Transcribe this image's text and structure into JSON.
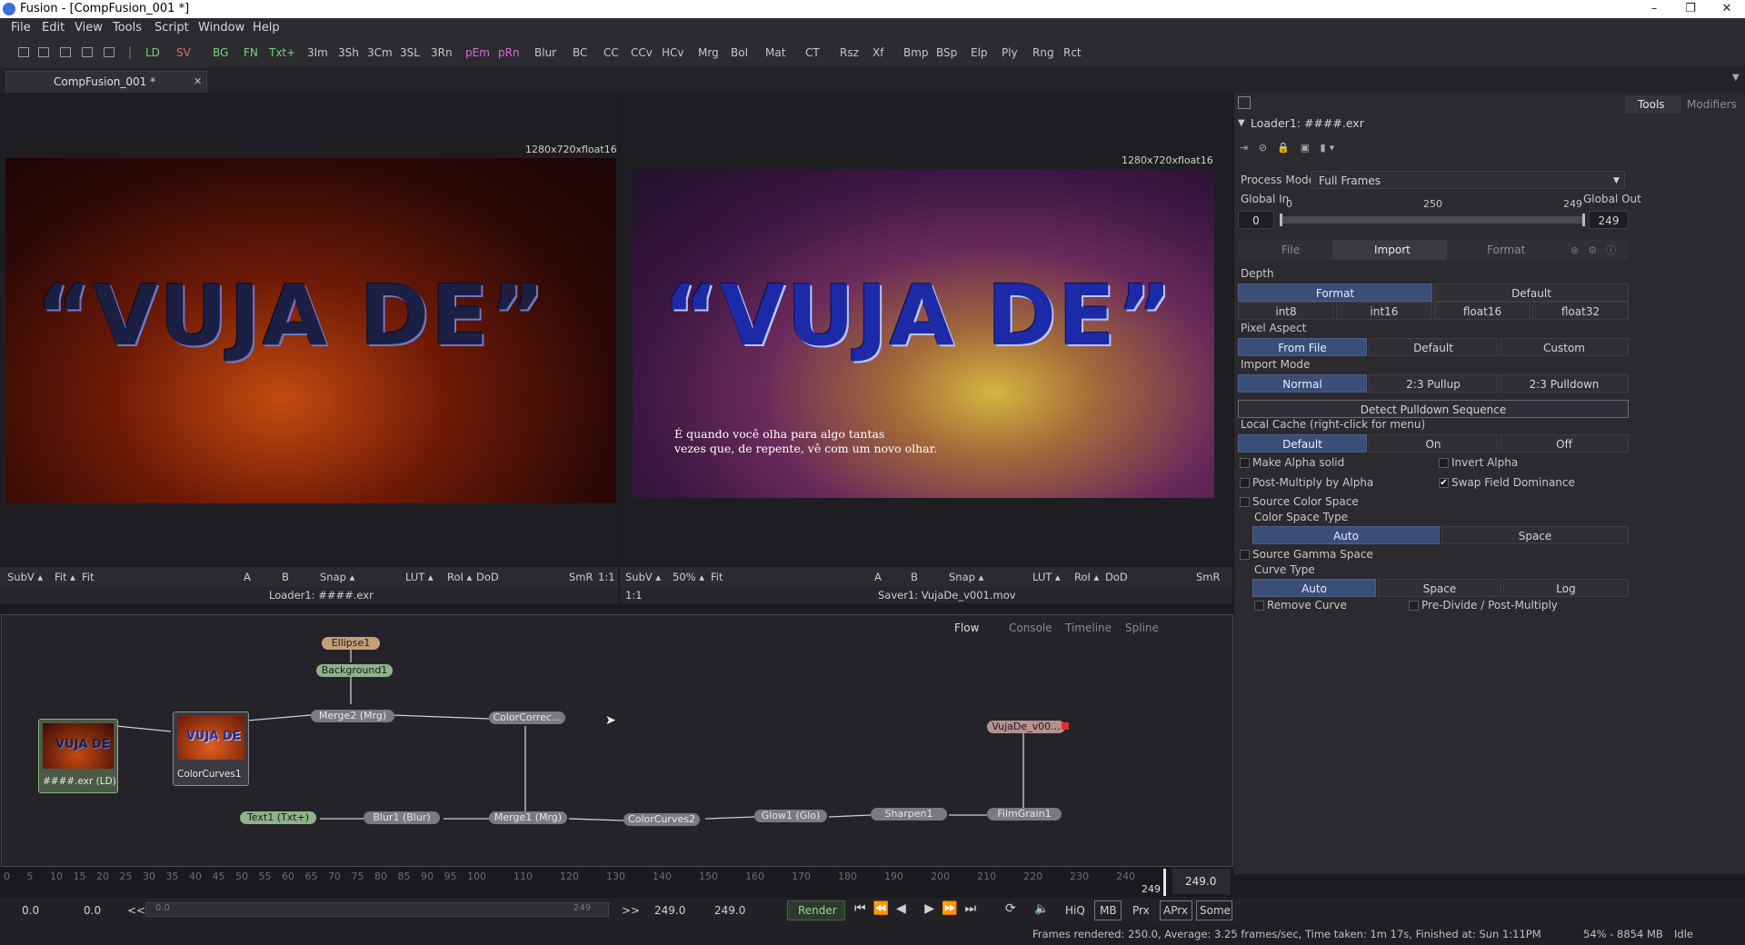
{
  "window": {
    "title": "Fusion - [CompFusion_001 *]",
    "controls": [
      "–",
      "❐",
      "✕"
    ]
  },
  "menu": [
    "File",
    "Edit",
    "View",
    "Tools",
    "Script",
    "Window",
    "Help"
  ],
  "toolbar": {
    "buttons": [
      "LD",
      "SV",
      "BG",
      "FN",
      "Txt+",
      "3Im",
      "3Sh",
      "3Cm",
      "3SL",
      "3Rn",
      "pEm",
      "pRn",
      "Blur",
      "BC",
      "CC",
      "CCv",
      "HCv",
      "Mrg",
      "BoI",
      "Mat",
      "CT",
      "Rsz",
      "Xf",
      "Bmp",
      "BSp",
      "Elp",
      "Ply",
      "Rng",
      "Rct"
    ],
    "colors": {
      "green": "#7fd17a",
      "red": "#e36b6b",
      "magenta": "#d66bd0",
      "default": "#c8c8c8"
    }
  },
  "document_tab": {
    "label": "CompFusion_001 *",
    "close": "✕"
  },
  "viewer_left": {
    "resolution": "1280x720xfloat16",
    "title_text": "“VUJA DE”",
    "toolbar": [
      "SubV ▴",
      "Fit ▴",
      "Fit",
      "A",
      "B",
      "Snap ▴",
      "LUT ▴",
      "RoI ▴",
      "DoD",
      "SmR",
      "1:1"
    ],
    "footer": "Loader1: ####.exr"
  },
  "viewer_right": {
    "resolution": "1280x720xfloat16",
    "title_text": "“VUJA DE”",
    "subtitle_line1": "É quando você olha para algo tantas",
    "subtitle_line2": "vezes que, de repente, vê com um novo olhar.",
    "toolbar": [
      "SubV ▴",
      "50% ▴",
      "Fit",
      "A",
      "B",
      "Snap ▴",
      "LUT ▴",
      "RoI ▴",
      "DoD",
      "SmR"
    ],
    "footer": "Saver1: VujaDe_v001.mov",
    "footer_left": "1:1"
  },
  "flow": {
    "tabs": [
      "Flow",
      "Console",
      "Timeline",
      "Spline"
    ],
    "nodes": {
      "ellipse": "Ellipse1",
      "background": "Background1",
      "merge2": "Merge2 (Mrg)",
      "colorcorrector": "ColorCorrec...",
      "loader": "####.exr (LD)",
      "colorcurves1": "ColorCurves1",
      "saver": "VujaDe_v00...",
      "text": "Text1 (Txt+)",
      "blur": "Blur1 (Blur)",
      "merge1": "Merge1 (Mrg)",
      "colorcurves2": "ColorCurves2",
      "glow": "Glow1 (Glo)",
      "sharpen": "Sharpen1",
      "filmgrain": "FilmGrain1",
      "thumb_text": "VUJA DE"
    }
  },
  "inspector": {
    "top_tabs": [
      "Tools",
      "Modifiers"
    ],
    "tool_name": "Loader1: ####.exr",
    "process_mode_label": "Process Mode",
    "process_mode_value": "Full Frames",
    "global_in_label": "Global In",
    "global_out_label": "Global Out",
    "global_in_value": "0",
    "global_out_value": "249",
    "slider_min": "0",
    "slider_mid": "250",
    "slider_max": "249",
    "sub_tabs": [
      "File",
      "Import",
      "Format"
    ],
    "depth_label": "Depth",
    "depth_row1": [
      "Format",
      "Default"
    ],
    "depth_row2": [
      "int8",
      "int16",
      "float16",
      "float32"
    ],
    "pixel_aspect_label": "Pixel Aspect",
    "pixel_aspect": [
      "From File",
      "Default",
      "Custom"
    ],
    "import_mode_label": "Import Mode",
    "import_mode": [
      "Normal",
      "2:3 Pullup",
      "2:3 Pulldown"
    ],
    "detect_pulldown": "Detect Pulldown Sequence",
    "local_cache_label": "Local Cache (right-click for menu)",
    "local_cache": [
      "Default",
      "On",
      "Off"
    ],
    "make_alpha_solid": "Make Alpha solid",
    "invert_alpha": "Invert Alpha",
    "post_multiply": "Post-Multiply by Alpha",
    "swap_field": "Swap Field Dominance",
    "source_color_space": "Source Color Space",
    "color_space_type": "Color Space Type",
    "color_space_opts": [
      "Auto",
      "Space"
    ],
    "source_gamma_space": "Source Gamma Space",
    "curve_type": "Curve Type",
    "curve_opts": [
      "Auto",
      "Space",
      "Log"
    ],
    "remove_curve": "Remove Curve",
    "pre_divide": "Pre-Divide / Post-Multiply"
  },
  "ruler": {
    "ticks": [
      "0",
      "5",
      "10",
      "15",
      "20",
      "25",
      "30",
      "35",
      "40",
      "45",
      "50",
      "55",
      "60",
      "65",
      "70",
      "75",
      "80",
      "85",
      "90",
      "95",
      "100",
      "110",
      "120",
      "130",
      "140",
      "150",
      "160",
      "170",
      "180",
      "190",
      "200",
      "210",
      "220",
      "230",
      "240"
    ],
    "current": "249",
    "current_value": "249.0"
  },
  "transport": {
    "start": "0.0",
    "render_start": "0.0",
    "prev": "<<",
    "range_end": "249",
    "next": ">>",
    "render_end": "249.0",
    "end": "249.0",
    "render_button": "Render",
    "quality": [
      "HiQ",
      "MB",
      "Prx",
      "APrx",
      "Some"
    ]
  },
  "status": {
    "message": "Frames rendered: 250.0,  Average: 3.25 frames/sec,  Time taken: 1m 17s,  Finished at: Sun 1:11PM",
    "memory": "54% - 8854 MB",
    "state": "Idle"
  }
}
